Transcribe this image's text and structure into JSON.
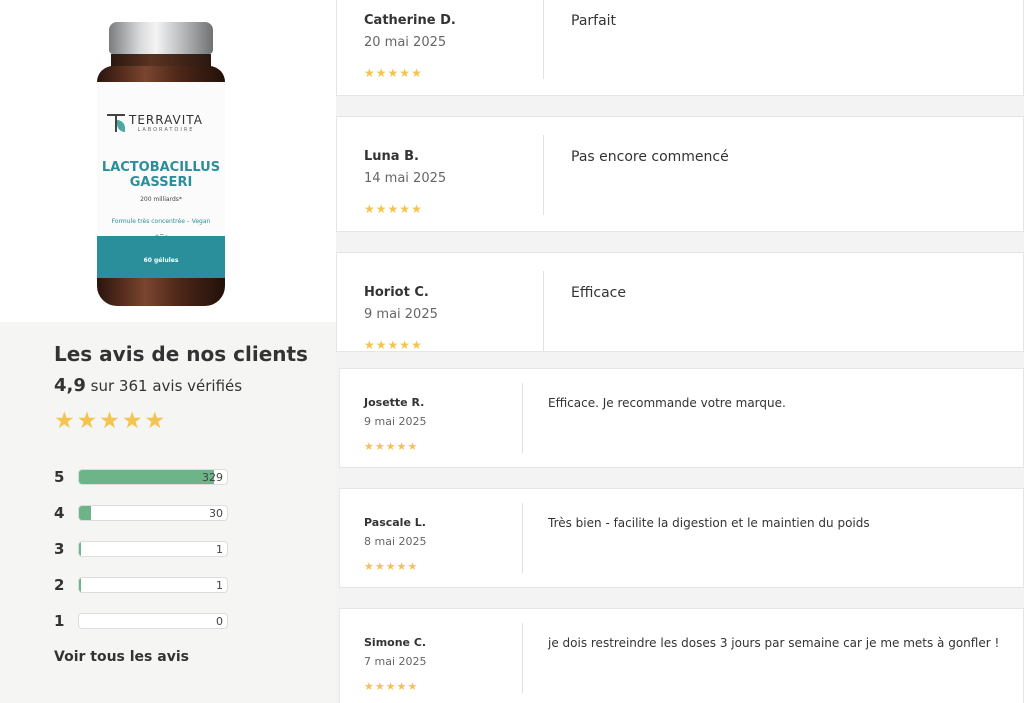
{
  "product": {
    "brand": "TERRAVITA",
    "brand_sub": "LABORATOIRE",
    "name_line1": "LACTOBACILLUS",
    "name_line2": "GASSERI",
    "dose": "200 milliards*",
    "formula": "Formule très concentrée – Vegan",
    "count": "60 gélules"
  },
  "summary": {
    "title": "Les avis de nos clients",
    "score": "4,9",
    "score_suffix": "sur 361 avis vérifiés",
    "stars": 5,
    "distribution": [
      {
        "label": "5",
        "count": "329",
        "fraction": 0.91
      },
      {
        "label": "4",
        "count": "30",
        "fraction": 0.08
      },
      {
        "label": "3",
        "count": "1",
        "fraction": 0.005
      },
      {
        "label": "2",
        "count": "1",
        "fraction": 0.005
      },
      {
        "label": "1",
        "count": "0",
        "fraction": 0
      }
    ],
    "see_all": "Voir tous les avis",
    "star_color": "#f4c44e",
    "bar_color": "#6db489"
  },
  "reviews": [
    {
      "author": "Catherine D.",
      "date": "20 mai 2025",
      "rating": 5,
      "comment": "Parfait"
    },
    {
      "author": "Luna B.",
      "date": "14 mai 2025",
      "rating": 5,
      "comment": "Pas encore commencé"
    },
    {
      "author": "Horiot C.",
      "date": "9 mai 2025",
      "rating": 5,
      "comment": "Efficace"
    },
    {
      "author": "Josette R.",
      "date": "9 mai 2025",
      "rating": 5,
      "comment": "Efficace. Je recommande votre marque."
    },
    {
      "author": "Pascale L.",
      "date": "8 mai 2025",
      "rating": 5,
      "comment": "Très bien - facilite la digestion et le maintien du poids"
    },
    {
      "author": "Simone C.",
      "date": "7 mai 2025",
      "rating": 5,
      "comment": "je dois restreindre les doses 3 jours par semaine car je me mets à gonfler !"
    }
  ]
}
